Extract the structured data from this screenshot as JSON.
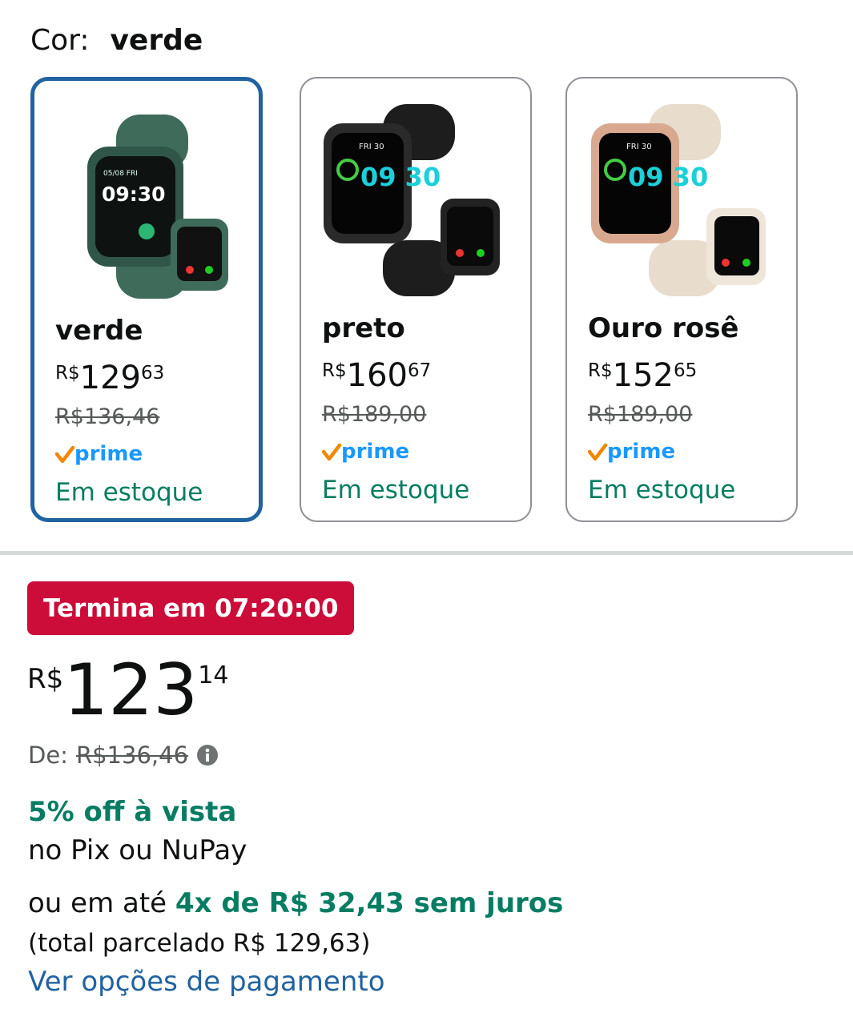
{
  "color_selector": {
    "label": "Cor:",
    "selected": "verde"
  },
  "variants": [
    {
      "name": "verde",
      "currency": "R$",
      "whole": "129",
      "fraction": "63",
      "list_price": "R$136,46",
      "prime": "prime",
      "stock": "Em estoque",
      "selected": true
    },
    {
      "name": "preto",
      "currency": "R$",
      "whole": "160",
      "fraction": "67",
      "list_price": "R$189,00",
      "prime": "prime",
      "stock": "Em estoque",
      "selected": false
    },
    {
      "name": "Ouro rosê",
      "currency": "R$",
      "whole": "152",
      "fraction": "65",
      "list_price": "R$189,00",
      "prime": "prime",
      "stock": "Em estoque",
      "selected": false
    }
  ],
  "watch_faces": [
    {
      "date": "05/08 FRI",
      "time": "09:30"
    },
    {
      "date": "FRI 30",
      "time": "09 30"
    },
    {
      "date": "FRI 30",
      "time": "09 30"
    }
  ],
  "deal": {
    "label": "Termina em 07:20:00"
  },
  "price": {
    "currency": "R$",
    "whole": "123",
    "fraction": "14"
  },
  "list_price": {
    "label": "De:",
    "value": "R$136,46"
  },
  "pix": {
    "discount": "5% off à vista",
    "methods": "no Pix ou NuPay"
  },
  "installments": {
    "prefix": "ou em até",
    "highlight": "4x de R$ 32,43 sem juros",
    "total": "(total parcelado R$ 129,63)"
  },
  "payment_link": "Ver opções de pagamento",
  "colors": {
    "selected_border": "#2162a1",
    "deal_red": "#cc0c39",
    "green": "#067d62",
    "link": "#2162a1",
    "prime_check": "#f08804",
    "prime_blue": "#1a98ff"
  }
}
